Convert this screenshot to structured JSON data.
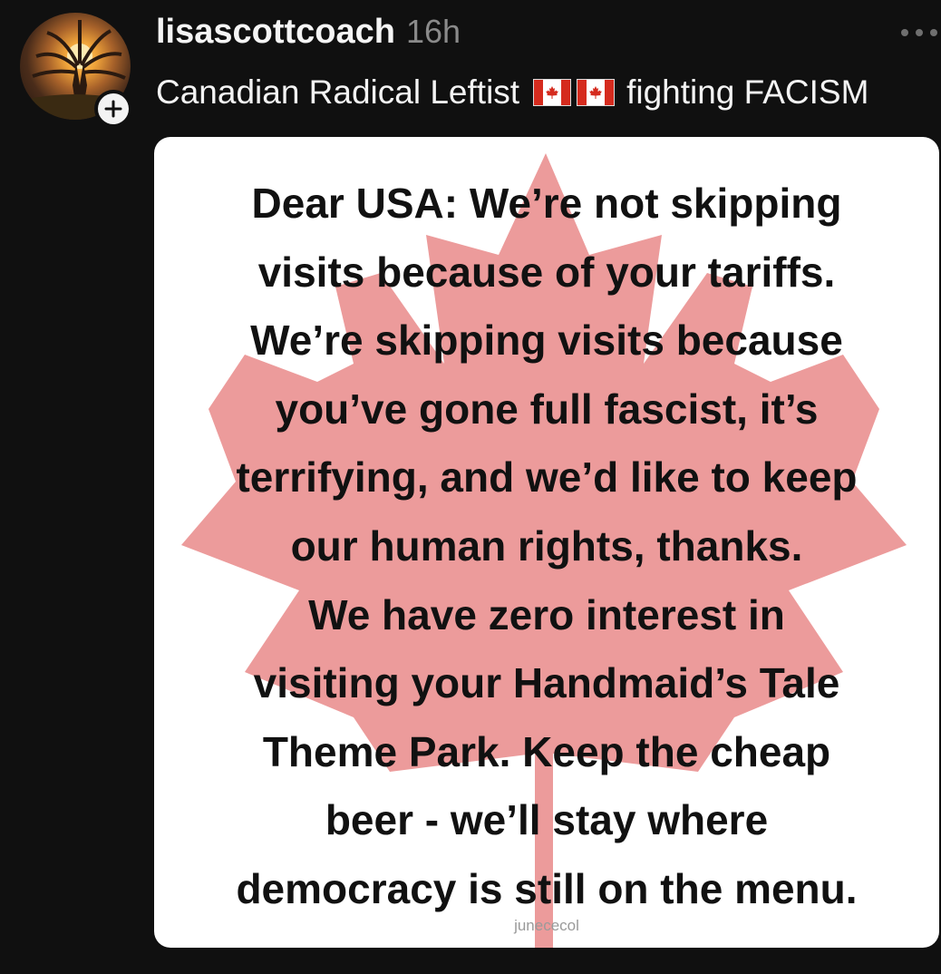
{
  "post": {
    "username": "lisascottcoach",
    "timestamp": "16h",
    "bio_prefix": "Canadian Radical Leftist",
    "bio_suffix": "fighting FACISM",
    "image_lines": [
      "Dear USA: We’re not skipping",
      "visits because of your tariffs.",
      "We’re skipping visits because",
      "you’ve gone full fascist, it’s",
      "terrifying, and we’d like to keep",
      "our human rights, thanks.",
      "We have zero interest in",
      "visiting your Handmaid’s Tale",
      "Theme Park. Keep the cheap",
      "beer - we’ll stay where",
      "democracy is still on the menu."
    ],
    "image_watermark": "junececol"
  },
  "icons": {
    "avatar": "tree-sunset-avatar",
    "follow": "plus-icon",
    "more": "more-horizontal-icon",
    "flag": "canada-flag-icon",
    "leaf": "maple-leaf-graphic"
  },
  "colors": {
    "background": "#101010",
    "text_primary": "#f3f3f3",
    "text_secondary": "#8a8a8a",
    "leaf": "#ec9b9b",
    "flag_red": "#d52b1e"
  }
}
